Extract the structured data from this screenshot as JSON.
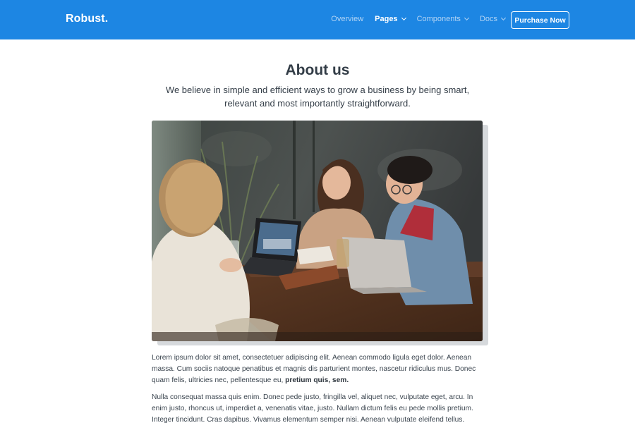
{
  "brand": "Robust.",
  "nav": {
    "items": [
      {
        "label": "Overview"
      },
      {
        "label": "Pages"
      },
      {
        "label": "Components"
      },
      {
        "label": "Docs"
      }
    ],
    "purchase_label": "Purchase Now"
  },
  "hero": {
    "title": "About us",
    "lead": "We believe in simple and efficient ways to grow a business by being smart, relevant and most importantly straightforward."
  },
  "content": {
    "p1_text": "Lorem ipsum dolor sit amet, consectetuer adipiscing elit. Aenean commodo ligula eget dolor. Aenean massa. Cum sociis natoque penatibus et magnis dis parturient montes, nascetur ridiculus mus. Donec quam felis, ultricies nec, pellentesque eu, ",
    "p1_bold": "pretium quis, sem.",
    "p2_text": "Nulla consequat massa quis enim. Donec pede justo, fringilla vel, aliquet nec, vulputate eget, arcu. In enim justo, rhoncus ut, imperdiet a, venenatis vitae, justo. Nullam dictum felis eu pede mollis pretium. Integer tincidunt. Cras dapibus. Vivamus elementum semper nisi. Aenean vulputate eleifend tellus. Aenean leo"
  },
  "colors": {
    "navbar": "#1d86e3",
    "text": "#333d47"
  }
}
